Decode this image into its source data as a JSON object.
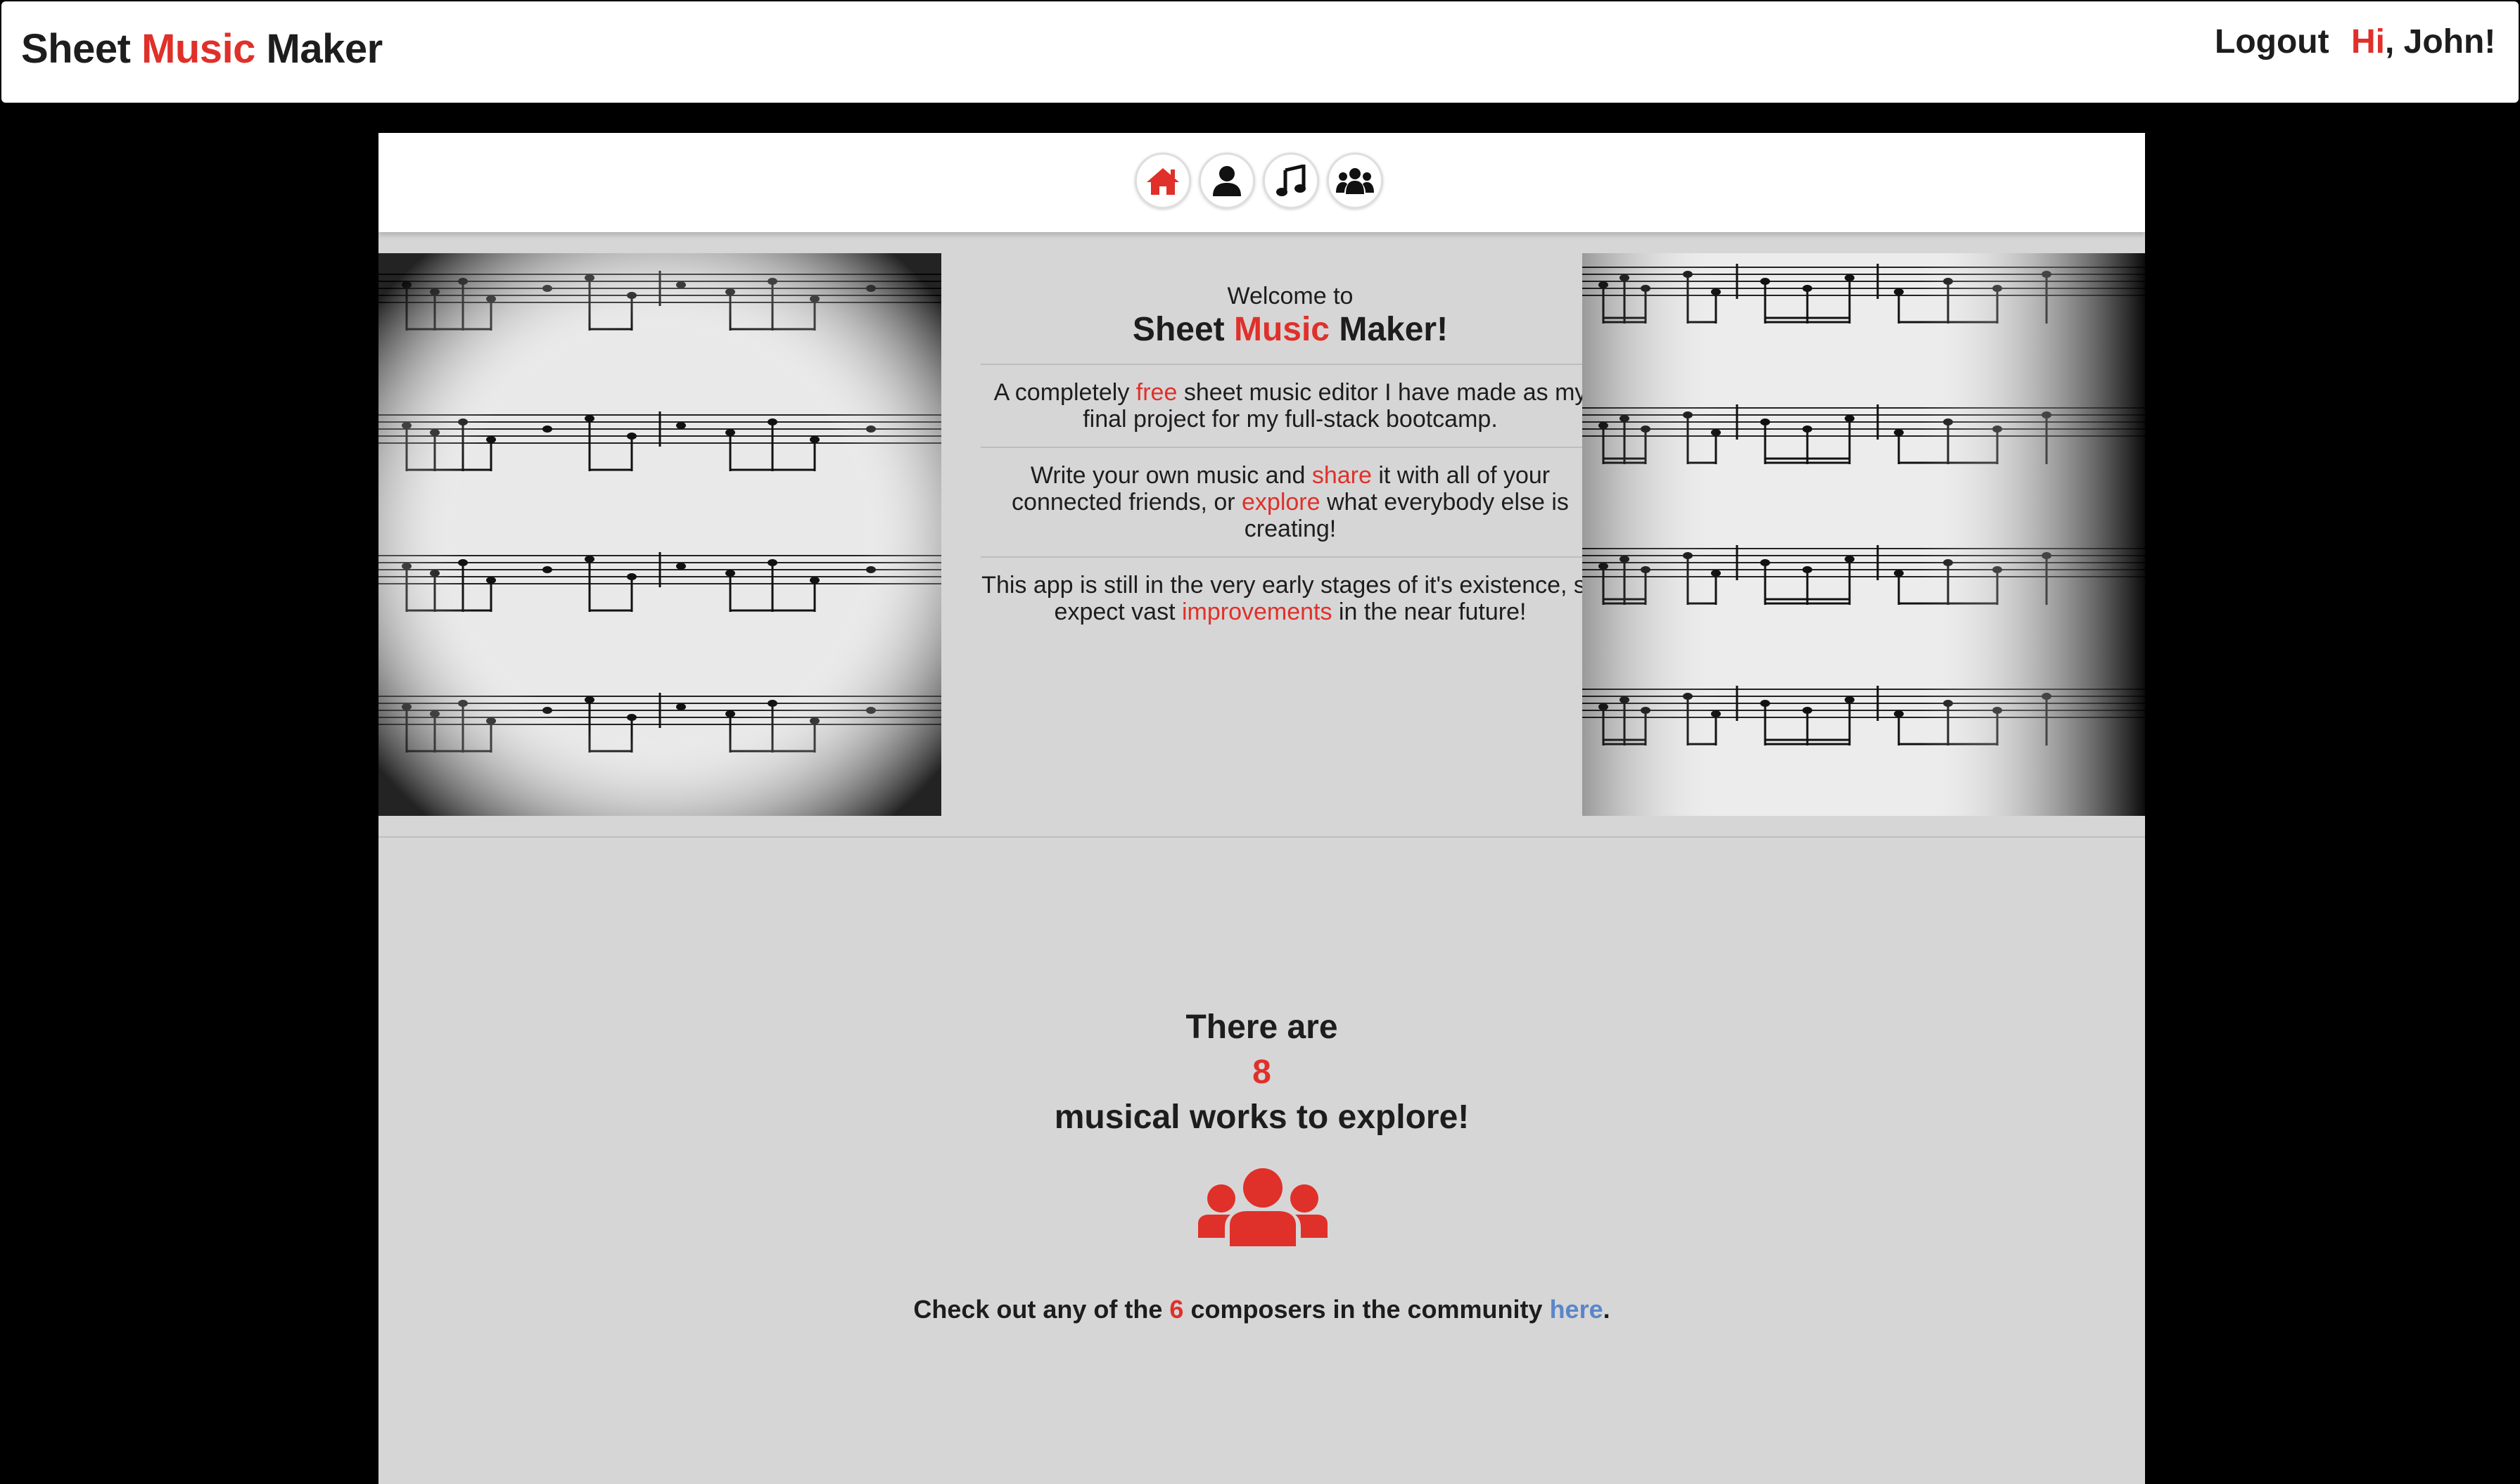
{
  "brand": {
    "part1": "Sheet ",
    "part2": "Music",
    "part3": " Maker"
  },
  "header": {
    "logout": "Logout",
    "greeting_hi": "Hi",
    "greeting_rest": ", John!"
  },
  "icons": [
    "home-icon",
    "user-icon",
    "music-note-icon",
    "users-icon"
  ],
  "welcome": {
    "small": "Welcome to",
    "title_part1": "Sheet ",
    "title_part2": "Music",
    "title_part3": " Maker!",
    "p1_a": "A completely ",
    "p1_b": "free",
    "p1_c": " sheet music editor I have made as my final project for my full-stack bootcamp.",
    "p2_a": "Write your own music and ",
    "p2_b": "share",
    "p2_c": " it with all of your connected friends, or ",
    "p2_d": "explore",
    "p2_e": " what everybody else is creating!",
    "p3_a": "This app is still in the very early stages of it's existence, so expect vast ",
    "p3_b": "improvements",
    "p3_c": " in the near future!"
  },
  "stats": {
    "line1": "There are",
    "count": "8",
    "line3": "musical works to explore!",
    "community_a": "Check out any of the ",
    "community_count": "6",
    "community_b": " composers in the community ",
    "community_link": "here",
    "community_end": "."
  },
  "colors": {
    "accent": "#e0302a",
    "link": "#5b86c9",
    "panel": "#d6d6d6"
  }
}
